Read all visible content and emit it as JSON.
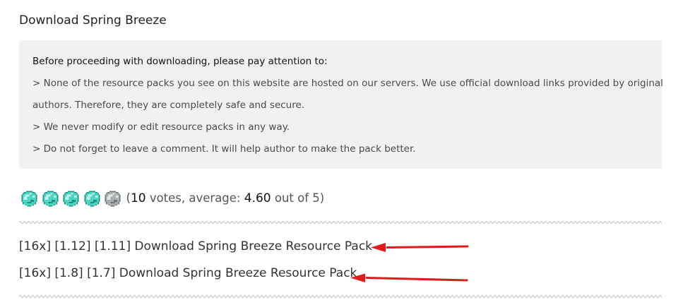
{
  "section": {
    "title": "Download Spring Breeze"
  },
  "notice": {
    "heading": "Before proceeding with downloading, please pay attention to:",
    "lines": [
      "> None of the resource packs you see on this website are hosted on our servers. We use official download links provided by original",
      "authors. Therefore, they are completely safe and secure.",
      "> We never modify or edit resource packs in any way.",
      "> Do not forget to leave a comment. It will help author to make the pack better."
    ]
  },
  "rating": {
    "icon": "diamond-gem-icon",
    "max": 5,
    "value": 4.6,
    "open": "(",
    "votes": "10",
    "votes_text": " votes, average: ",
    "average": "4.60",
    "out_of_text": " out of 5)"
  },
  "downloads": [
    {
      "label": "[16x] [1.12] [1.11] Download Spring Breeze Resource Pack"
    },
    {
      "label": "[16x] [1.8] [1.7] Download Spring Breeze Resource Pack"
    }
  ],
  "colors": {
    "notice_background": "#f1f1f1",
    "gem_light": "#bdf3ea",
    "gem_mid": "#4fd3c3",
    "gem_dark": "#1f8f85",
    "gem_empty": "#a9aeb0",
    "arrow": "#e01b1b",
    "wavy_line": "#c9c9c9"
  }
}
